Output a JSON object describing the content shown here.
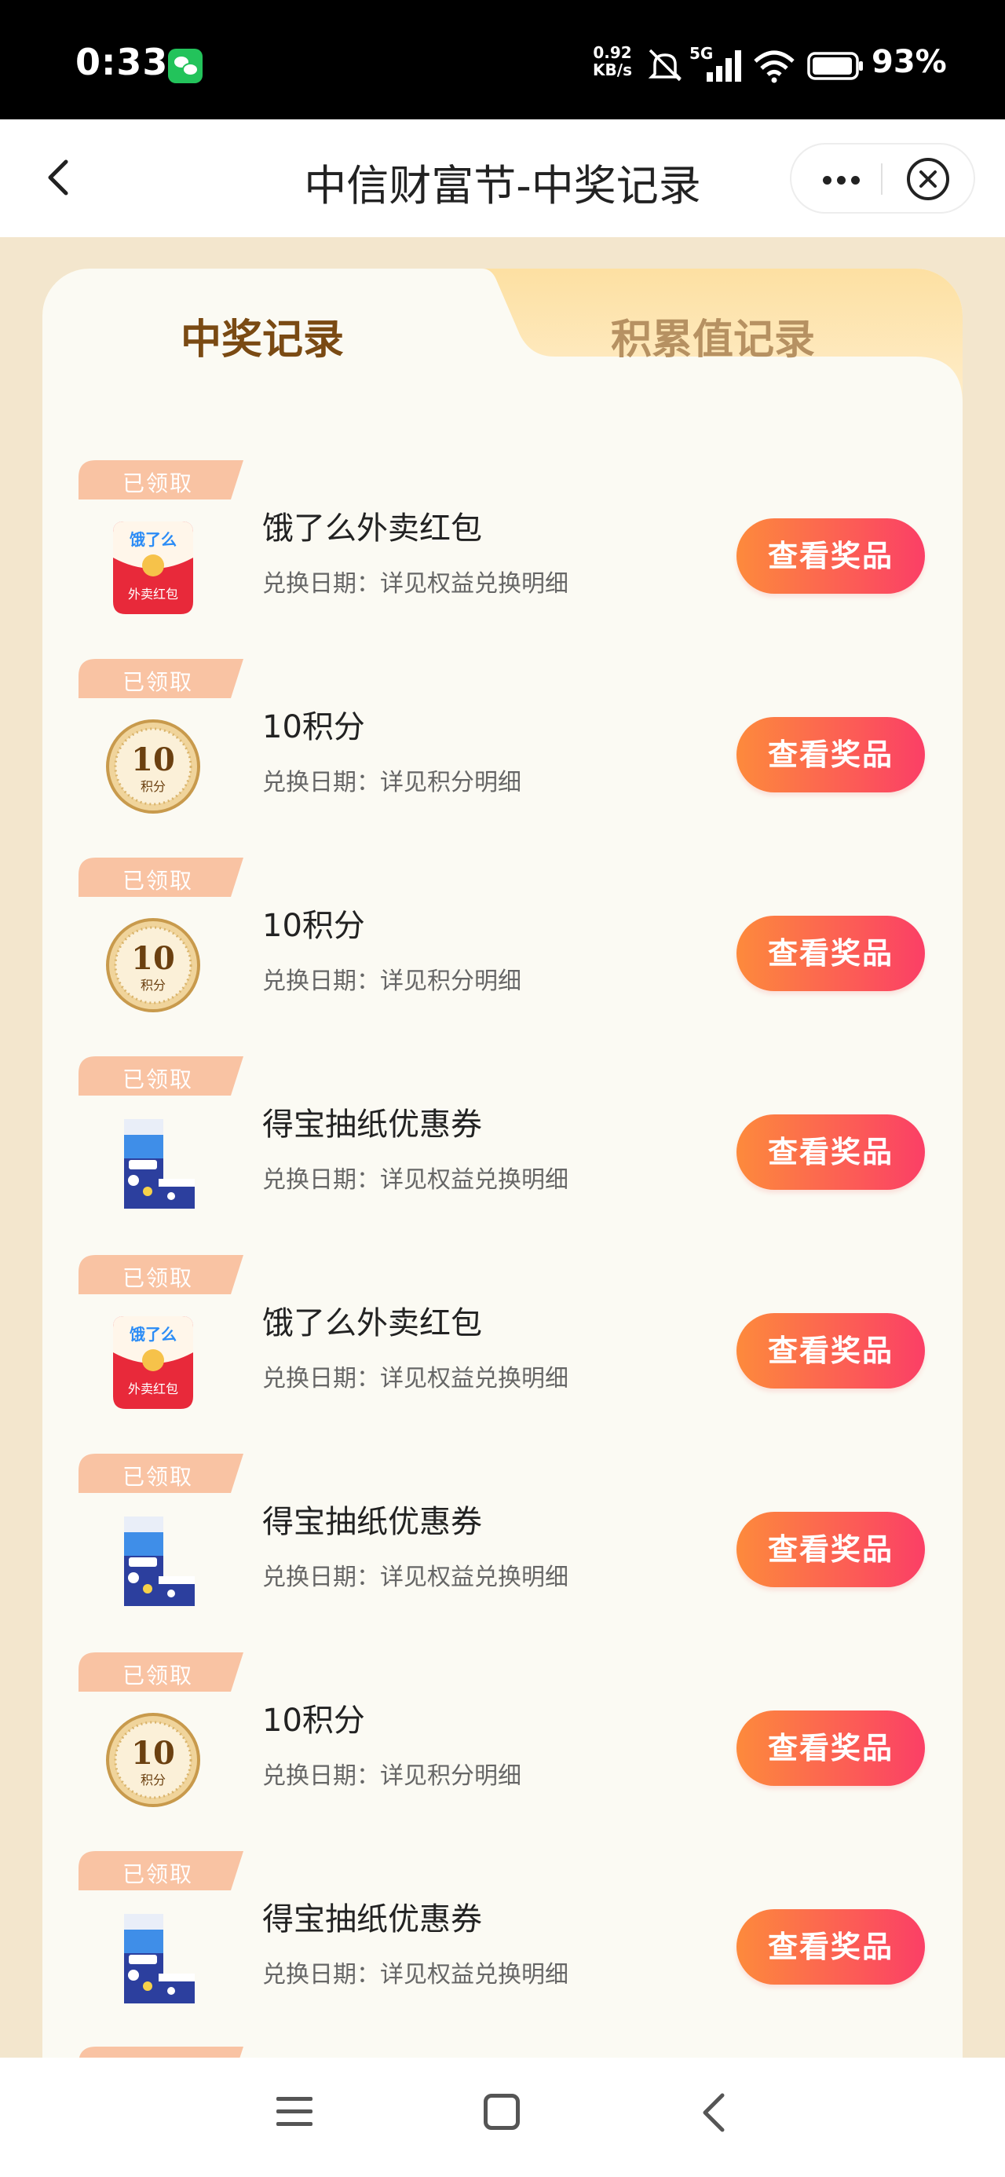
{
  "status_bar": {
    "time": "0:33",
    "net_speed_value": "0.92",
    "net_speed_unit": "KB/s",
    "signal_label": "5G",
    "battery": "93%"
  },
  "header": {
    "title": "中信财富节-中奖记录"
  },
  "tabs": [
    {
      "label": "中奖记录",
      "active": true
    },
    {
      "label": "积累值记录",
      "active": false
    }
  ],
  "items": [
    {
      "badge": "已领取",
      "thumb": "eleme-redpacket",
      "thumb_logo": "饿了么",
      "thumb_caption": "外卖红包",
      "title": "饿了么外卖红包",
      "subtitle": "兑换日期：详见权益兑换明细",
      "button": "查看奖品"
    },
    {
      "badge": "已领取",
      "thumb": "points-coin",
      "coin_value": "10",
      "coin_caption": "积分",
      "title": "10积分",
      "subtitle": "兑换日期：详见积分明细",
      "button": "查看奖品"
    },
    {
      "badge": "已领取",
      "thumb": "points-coin",
      "coin_value": "10",
      "coin_caption": "积分",
      "title": "10积分",
      "subtitle": "兑换日期：详见积分明细",
      "button": "查看奖品"
    },
    {
      "badge": "已领取",
      "thumb": "tissue-pack",
      "title": "得宝抽纸优惠券",
      "subtitle": "兑换日期：详见权益兑换明细",
      "button": "查看奖品"
    },
    {
      "badge": "已领取",
      "thumb": "eleme-redpacket",
      "thumb_logo": "饿了么",
      "thumb_caption": "外卖红包",
      "title": "饿了么外卖红包",
      "subtitle": "兑换日期：详见权益兑换明细",
      "button": "查看奖品"
    },
    {
      "badge": "已领取",
      "thumb": "tissue-pack",
      "title": "得宝抽纸优惠券",
      "subtitle": "兑换日期：详见权益兑换明细",
      "button": "查看奖品"
    },
    {
      "badge": "已领取",
      "thumb": "points-coin",
      "coin_value": "10",
      "coin_caption": "积分",
      "title": "10积分",
      "subtitle": "兑换日期：详见积分明细",
      "button": "查看奖品"
    },
    {
      "badge": "已领取",
      "thumb": "tissue-pack",
      "title": "得宝抽纸优惠券",
      "subtitle": "兑换日期：详见权益兑换明细",
      "button": "查看奖品"
    }
  ],
  "colors": {
    "accent_gradient_start": "#fd8a3c",
    "accent_gradient_end": "#fb3f66",
    "badge": "#f9c3a3",
    "page_bg": "#f3e6cd",
    "tab_active_text": "#7a4a13",
    "tab_inactive_text": "#b69162"
  }
}
